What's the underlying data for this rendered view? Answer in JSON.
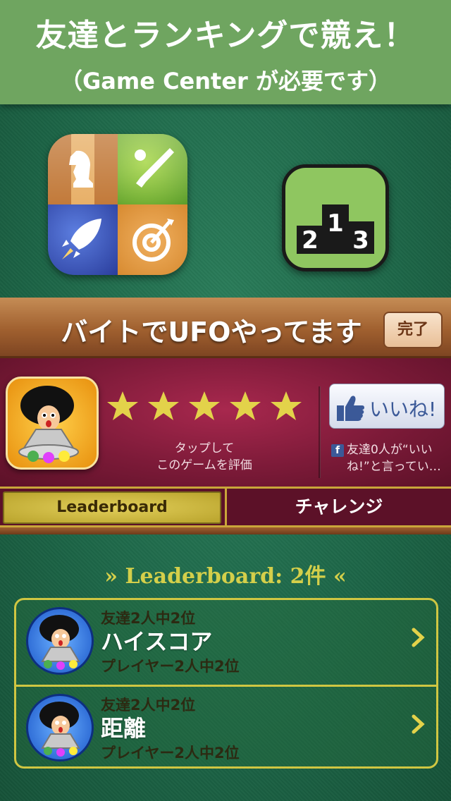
{
  "banner": {
    "title": "友達とランキングで競え！",
    "subtitle": "（Game Center が必要です）"
  },
  "icons": {
    "game_center": "game-center-icon",
    "podium": "podium-ranking-icon",
    "podium_numbers": [
      "2",
      "1",
      "3"
    ]
  },
  "game_center_panel": {
    "title": "バイトでUFOやってます",
    "done_label": "完了",
    "rating": {
      "stars": 5,
      "prompt_line1": "タップして",
      "prompt_line2": "このゲームを評価"
    },
    "like_label": "いいね!",
    "fb_glyph": "f",
    "friends_like_text": "友達0人が“いいね!”と言ってい…",
    "tabs": [
      {
        "label": "Leaderboard",
        "active": true
      },
      {
        "label": "チャレンジ",
        "active": false
      }
    ]
  },
  "leaderboard": {
    "header_prefix": "»",
    "header": "Leaderboard: 2件",
    "header_suffix": "«",
    "items": [
      {
        "rank_friends": "友達2人中2位",
        "name": "ハイスコア",
        "rank_players": "プレイヤー2人中2位"
      },
      {
        "rank_friends": "友達2人中2位",
        "name": "距離",
        "rank_players": "プレイヤー2人中2位"
      }
    ]
  },
  "colors": {
    "banner": "#6fa560",
    "felt": "#1f6a4c",
    "wood": "#a0602f",
    "crimson": "#7c1a38",
    "gold": "#cfc642",
    "star": "#e3d24a"
  }
}
